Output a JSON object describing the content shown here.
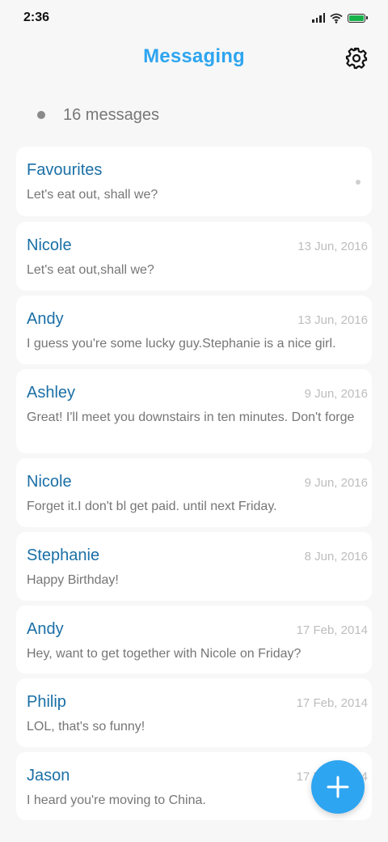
{
  "status_bar": {
    "time": "2:36"
  },
  "header": {
    "title": "Messaging"
  },
  "summary": {
    "count_text": "16 messages"
  },
  "conversations": [
    {
      "name": "Favourites",
      "date": "",
      "preview": "Let's eat out, shall we?",
      "unread": true
    },
    {
      "name": "Nicole",
      "date": "13 Jun, 2016",
      "preview": "Let's eat out,shall we?"
    },
    {
      "name": "Andy",
      "date": "13 Jun, 2016",
      "preview": "I guess you're some lucky guy.Stephanie is a nice girl."
    },
    {
      "name": "Ashley",
      "date": "9 Jun, 2016",
      "preview": "Great! I'll meet you downstairs in ten minutes. Don't forge"
    },
    {
      "name": "Nicole",
      "date": "9 Jun, 2016",
      "preview": "Forget it.I don't bl get paid. until next Friday."
    },
    {
      "name": "Stephanie",
      "date": "8 Jun, 2016",
      "preview": "Happy Birthday!"
    },
    {
      "name": "Andy",
      "date": "17 Feb, 2014",
      "preview": "Hey, want to get together with Nicole on Friday?"
    },
    {
      "name": "Philip",
      "date": "17 Feb, 2014",
      "preview": "LOL, that's so funny!"
    },
    {
      "name": "Jason",
      "date": "17 Feb, 2014",
      "preview": "I heard you're moving to China."
    }
  ],
  "colors": {
    "accent": "#2ea5f0",
    "name": "#1a6fa6",
    "battery": "#17b34a"
  },
  "icons": {
    "settings": "gear-icon",
    "compose": "plus-icon"
  }
}
